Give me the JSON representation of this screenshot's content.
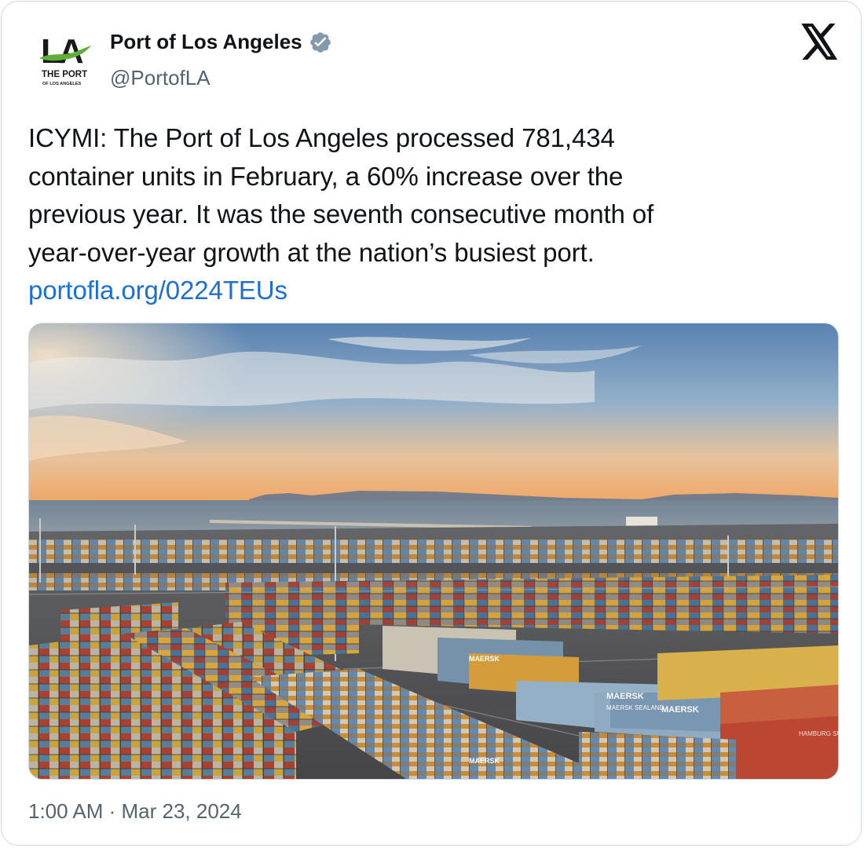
{
  "author": {
    "name": "Port of Los Angeles",
    "handle": "@PortofLA",
    "verified": true,
    "logo": {
      "mark": "LA",
      "line1": "THE PORT",
      "line2": "OF LOS ANGELES"
    }
  },
  "tweet": {
    "lines": [
      "ICYMI: The Port of Los Angeles processed 781,434",
      "container units in February, a 60% increase over the",
      "previous year. It was the seventh consecutive month of",
      "year-over-year growth at the nation’s busiest port."
    ],
    "link": "portofla.org/0224TEUs"
  },
  "media": {
    "container_labels": [
      "MAERSK",
      "MAERSK SEALAND",
      "HAMBURG SÜD"
    ]
  },
  "timestamp": {
    "time": "1:00 AM",
    "separator": " · ",
    "date": "Mar 23, 2024"
  },
  "icons": {
    "platform": "x-logo-icon",
    "verified": "verified-badge-icon"
  },
  "colors": {
    "link": "#1d6fd1",
    "verified": "#829aab",
    "text": "#0f1419",
    "secondary": "#536471"
  }
}
